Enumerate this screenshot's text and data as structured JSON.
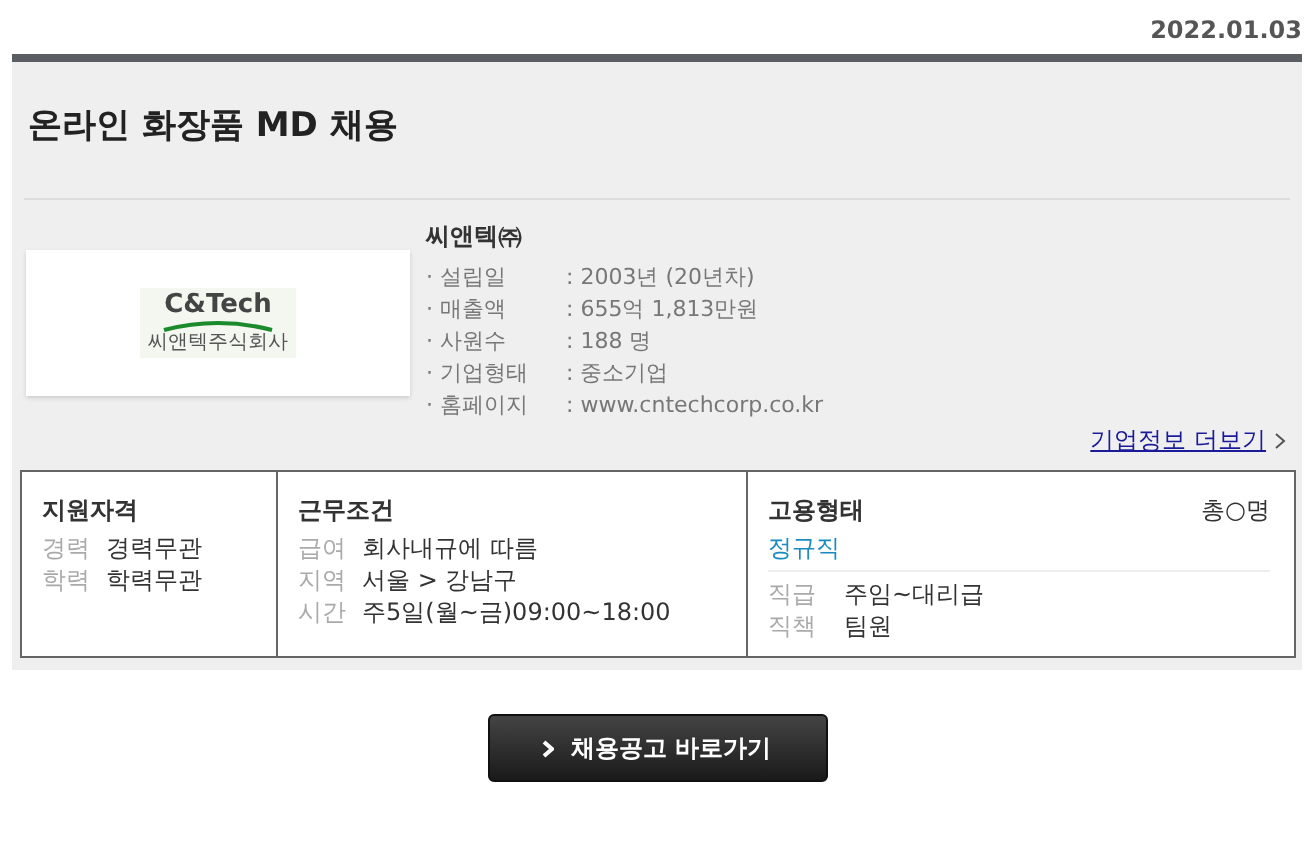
{
  "date": "2022.01.03",
  "title": "온라인 화장품 MD 채용",
  "company": {
    "logo_text": "C&Tech",
    "logo_subtext": "씨앤텍주식회사",
    "name": "씨앤텍㈜",
    "facts": [
      {
        "label": "· 설립일",
        "value": ": 2003년 (20년차)"
      },
      {
        "label": "· 매출액",
        "value": ": 655억 1,813만원"
      },
      {
        "label": "· 사원수",
        "value": ": 188 명"
      },
      {
        "label": "· 기업형태",
        "value": ": 중소기업"
      },
      {
        "label": "· 홈페이지",
        "value": ": www.cntechcorp.co.kr"
      }
    ],
    "more_link": "기업정보 더보기"
  },
  "qualifications": {
    "heading": "지원자격",
    "rows": [
      {
        "label": "경력",
        "value": "경력무관"
      },
      {
        "label": "학력",
        "value": "학력무관"
      }
    ]
  },
  "conditions": {
    "heading": "근무조건",
    "rows": [
      {
        "label": "급여",
        "value": "회사내규에 따름"
      },
      {
        "label": "지역",
        "value": "서울 > 강남구"
      },
      {
        "label": "시간",
        "value": "주5일(월~금)09:00~18:00"
      }
    ]
  },
  "employment": {
    "heading": "고용형태",
    "headcount": "총○명",
    "type": "정규직",
    "rows": [
      {
        "label": "직급",
        "value": "주임~대리급"
      },
      {
        "label": "직책",
        "value": "팀원"
      }
    ]
  },
  "apply_button": "채용공고 바로가기"
}
